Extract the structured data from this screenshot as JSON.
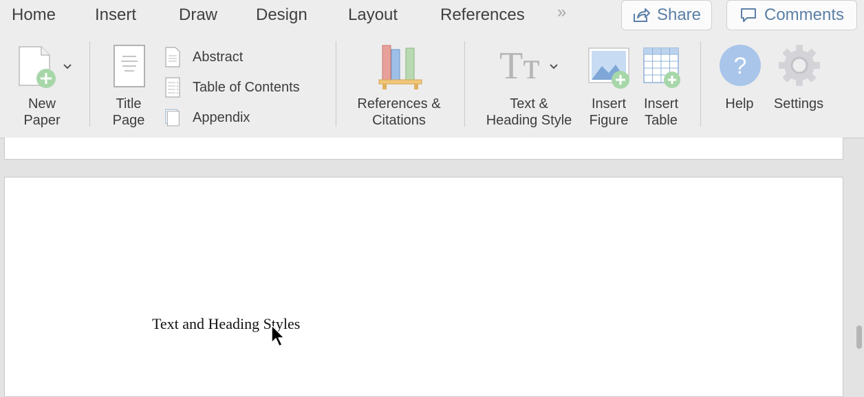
{
  "tabs": [
    {
      "label": "Home"
    },
    {
      "label": "Insert"
    },
    {
      "label": "Draw"
    },
    {
      "label": "Design"
    },
    {
      "label": "Layout"
    },
    {
      "label": "References"
    }
  ],
  "overflow_glyph": "»",
  "share_label": "Share",
  "comments_label": "Comments",
  "ribbon": {
    "new_paper": {
      "line1": "New",
      "line2": "Paper"
    },
    "title_page": {
      "line1": "Title",
      "line2": "Page"
    },
    "abstract": "Abstract",
    "toc": "Table of Contents",
    "appendix": "Appendix",
    "refs": {
      "line1": "References &",
      "line2": "Citations"
    },
    "text_style": {
      "line1": "Text &",
      "line2": "Heading Style"
    },
    "insert_figure": {
      "line1": "Insert",
      "line2": "Figure"
    },
    "insert_table": {
      "line1": "Insert",
      "line2": "Table"
    },
    "help": "Help",
    "settings": "Settings",
    "tt_glyph": "Tт"
  },
  "document": {
    "body_text": "Text and Heading Styles"
  },
  "colors": {
    "accent": "#5b7fa6",
    "help_circle": "#a9c5ea",
    "green_plus": "#a7d7a9"
  }
}
